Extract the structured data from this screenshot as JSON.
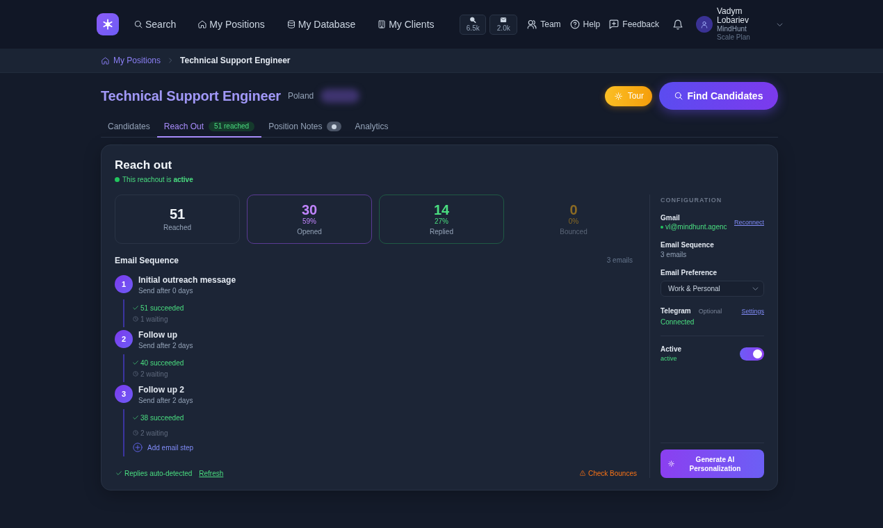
{
  "nav": {
    "items": [
      {
        "label": "Search"
      },
      {
        "label": "My Positions"
      },
      {
        "label": "My Database"
      },
      {
        "label": "My Clients"
      }
    ],
    "counters": [
      {
        "value": "6.5k"
      },
      {
        "value": "2.0k"
      }
    ],
    "links": [
      {
        "label": "Team"
      },
      {
        "label": "Help"
      },
      {
        "label": "Feedback"
      }
    ],
    "user": {
      "name": "Vadym Lobariev",
      "company": "MindHunt",
      "plan": "Scale Plan"
    }
  },
  "breadcrumb": [
    {
      "label": "My Positions",
      "current": false
    },
    {
      "label": "Technical Support Engineer",
      "current": true
    }
  ],
  "header": {
    "title": "Technical Support Engineer",
    "location": "Poland",
    "buttons": [
      {
        "label": "Tour",
        "kind": "tour"
      },
      {
        "label": "Find Candidates",
        "kind": "primary"
      }
    ]
  },
  "tabs": [
    {
      "label": "Candidates",
      "selected": false,
      "dot_badge": false
    },
    {
      "label": "Reach Out",
      "selected": true,
      "badge": "51 reached",
      "dot_badge": false
    },
    {
      "label": "Position Notes",
      "selected": false,
      "dot_badge": true
    },
    {
      "label": "Analytics",
      "selected": false,
      "dot_badge": false
    }
  ],
  "reach_out": {
    "title": "Reach out",
    "status": "This reachout is **active**",
    "active": true,
    "stats": [
      {
        "value": "51",
        "label": "Reached",
        "kind": "total",
        "color": "#f1f5f9"
      },
      {
        "value": "30",
        "percent": "59%",
        "label": "Opened",
        "kind": "opened",
        "color": "#c084fc"
      },
      {
        "value": "14",
        "percent": "27%",
        "label": "Replied",
        "kind": "replied",
        "color": "#4ade80"
      },
      {
        "value": "0",
        "percent": "0%",
        "label": "Bounced",
        "kind": "bounced",
        "color": "#8a6a24"
      }
    ],
    "sequence": {
      "title": "Email Sequence",
      "count": "3 emails",
      "steps": [
        {
          "number": "1",
          "title": "Initial outreach message",
          "delay": "Send after 0 days",
          "succeeded": "51 succeeded",
          "waiting": "1 waiting"
        },
        {
          "number": "2",
          "title": "Follow up",
          "delay": "Send after 2 days",
          "succeeded": "40 succeeded",
          "waiting": "2 waiting"
        },
        {
          "number": "3",
          "title": "Follow up 2",
          "delay": "Send after 2 days",
          "succeeded": "38 succeeded",
          "waiting": "2 waiting"
        }
      ],
      "add_label": "Add email step"
    },
    "footer": {
      "note": "Replies auto-detected",
      "link": "Refresh",
      "warning": "Check Bounces"
    }
  },
  "config": {
    "heading": "CONFIGURATION",
    "gmail": {
      "label": "Gmail",
      "account": "vl@mindhunt.agenc",
      "connected": true,
      "link": "Reconnect"
    },
    "sequence": {
      "label": "Email Sequence",
      "value": "3 emails"
    },
    "preference": {
      "label": "Email Preference",
      "value": "Work & Personal"
    },
    "telegram": {
      "label": "Telegram",
      "hint": "Optional",
      "link": "Settings",
      "status": "Connected"
    },
    "active": {
      "label": "Active",
      "status": "active",
      "on": true
    },
    "button": "Generate AI Personalization"
  }
}
